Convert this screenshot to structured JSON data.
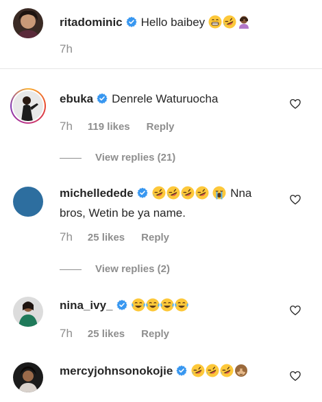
{
  "top_comment": {
    "username": "ritadominic",
    "text": "Hello baibey",
    "emojis": [
      "grin",
      "rofl",
      "facepalm"
    ],
    "time": "7h"
  },
  "comments": [
    {
      "username": "ebuka",
      "text": "Denrele Waturuocha",
      "time": "7h",
      "likes": "119 likes",
      "reply": "Reply",
      "view_replies": "View replies (21)"
    },
    {
      "username": "michelledede",
      "text_after_emojis": "Nna",
      "text_line2": "bros, Wetin be ya name.",
      "emojis": [
        "rofl",
        "rofl",
        "rofl",
        "rofl",
        "crying"
      ],
      "time": "7h",
      "likes": "25 likes",
      "reply": "Reply",
      "view_replies": "View replies (2)"
    },
    {
      "username": "nina_ivy_",
      "emojis": [
        "joy",
        "joy",
        "joy",
        "joy"
      ],
      "time": "7h",
      "likes": "25 likes",
      "reply": "Reply"
    },
    {
      "username": "mercyjohnsonokojie",
      "emojis": [
        "rofl",
        "rofl",
        "rofl",
        "see-no-evil"
      ]
    }
  ],
  "colors": {
    "verified": "#3897f0",
    "meta": "#8e8e8e",
    "text": "#262626",
    "avatar_blue": "#2d6e9f"
  }
}
